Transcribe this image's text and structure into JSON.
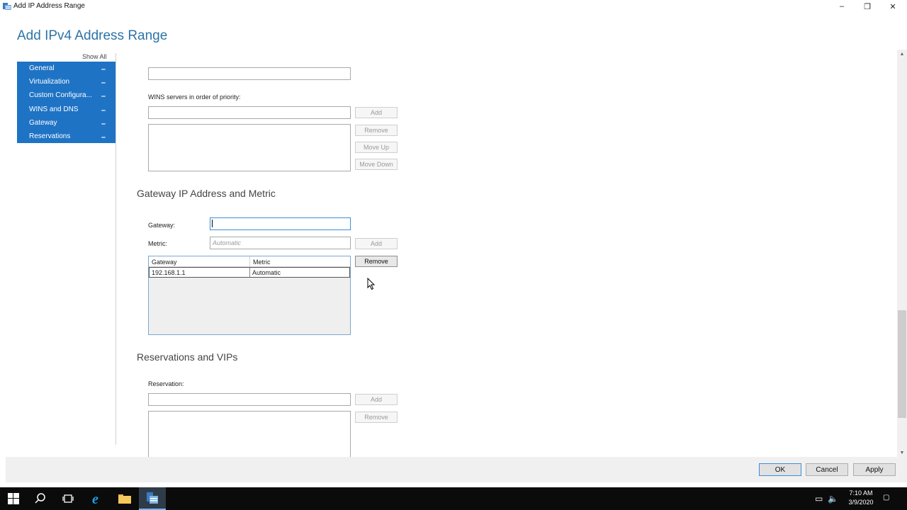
{
  "window": {
    "title": "Add IP Address Range",
    "minimize": "–",
    "restore": "❐",
    "close": "✕"
  },
  "page": {
    "heading": "Add IPv4 Address Range"
  },
  "nav": {
    "show_all": "Show All",
    "items": [
      {
        "label": "General",
        "toggle": "–"
      },
      {
        "label": "Virtualization",
        "toggle": "–"
      },
      {
        "label": "Custom Configura...",
        "toggle": "–"
      },
      {
        "label": "WINS and DNS",
        "toggle": "–"
      },
      {
        "label": "Gateway",
        "toggle": "–"
      },
      {
        "label": "Reservations",
        "toggle": "–"
      }
    ]
  },
  "wins": {
    "label": "WINS servers in order of priority:",
    "input_value": "",
    "buttons": {
      "add": "Add",
      "remove": "Remove",
      "move_up": "Move Up",
      "move_down": "Move Down"
    }
  },
  "gateway_section": {
    "heading": "Gateway IP Address and Metric",
    "gateway_label": "Gateway:",
    "gateway_value": "",
    "metric_label": "Metric:",
    "metric_placeholder": "Automatic",
    "add_button": "Add",
    "remove_button": "Remove",
    "columns": [
      "Gateway",
      "Metric"
    ],
    "rows": [
      {
        "gateway": "192.168.1.1",
        "metric": "Automatic"
      }
    ]
  },
  "reservations_section": {
    "heading": "Reservations and VIPs",
    "label": "Reservation:",
    "input_value": "",
    "add_button": "Add",
    "remove_button": "Remove"
  },
  "footer": {
    "ok": "OK",
    "cancel": "Cancel",
    "apply": "Apply"
  },
  "taskbar": {
    "time": "7:10 AM",
    "date": "3/9/2020"
  }
}
